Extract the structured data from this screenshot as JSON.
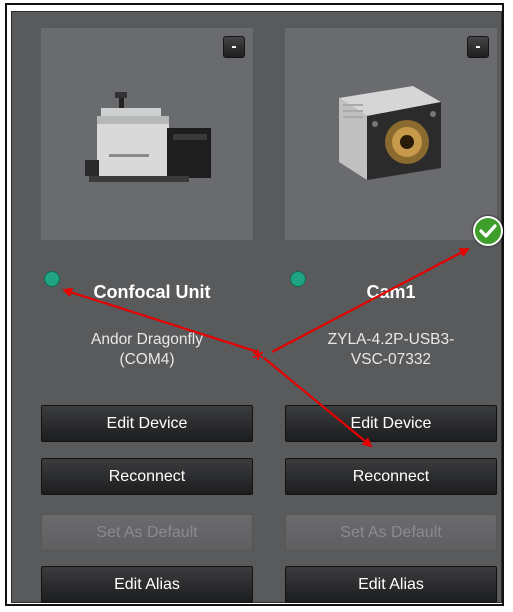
{
  "devices": [
    {
      "name": "Confocal Unit",
      "description_line1": "Andor Dragonfly",
      "description_line2": "(COM4)",
      "status_color": "#1fa383",
      "image_icon": "confocal-unit-image",
      "remove_label": "-",
      "is_default": false,
      "buttons": {
        "edit_device": "Edit Device",
        "reconnect": "Reconnect",
        "set_default": "Set As Default",
        "edit_alias": "Edit Alias"
      }
    },
    {
      "name": "Cam1",
      "description_line1": "ZYLA-4.2P-USB3-",
      "description_line2": "VSC-07332",
      "status_color": "#1fa383",
      "image_icon": "camera-image",
      "remove_label": "-",
      "is_default": true,
      "default_badge_icon": "check-icon",
      "buttons": {
        "edit_device": "Edit Device",
        "reconnect": "Reconnect",
        "set_default": "Set As Default",
        "edit_alias": "Edit Alias"
      }
    }
  ],
  "annotation": {
    "marker": "*",
    "color": "#e60000"
  }
}
